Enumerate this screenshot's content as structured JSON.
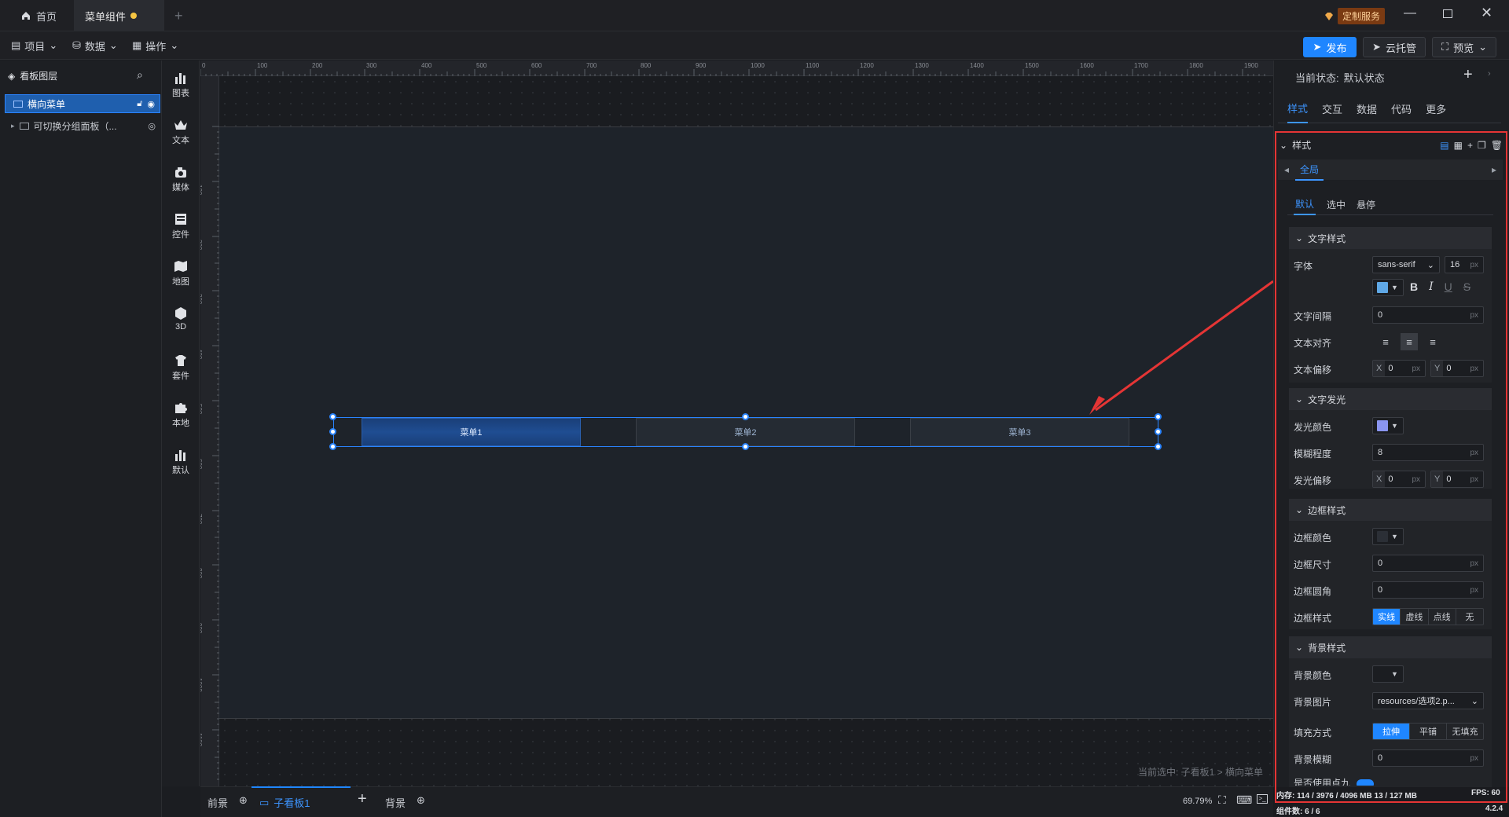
{
  "titlebar": {
    "tabs": [
      {
        "label": "首页",
        "icon": "home-icon"
      },
      {
        "label": "菜单组件",
        "modified": true
      }
    ],
    "service_label": "定制服务",
    "window_controls": [
      "minimize-icon",
      "restore-icon",
      "close-icon"
    ]
  },
  "menubar": {
    "project_label": "项目",
    "data_label": "数据",
    "ops_label": "操作",
    "publish_label": "发布",
    "cloud_label": "云托管",
    "preview_label": "预览"
  },
  "layers": {
    "title": "看板图层",
    "items": [
      {
        "label": "横向菜单",
        "selected": true
      },
      {
        "label": "可切换分组面板（...",
        "selected": false
      }
    ]
  },
  "tools": [
    {
      "label": "图表",
      "icon": "chart-icon"
    },
    {
      "label": "文本",
      "icon": "text-icon"
    },
    {
      "label": "媒体",
      "icon": "media-icon"
    },
    {
      "label": "控件",
      "icon": "control-icon"
    },
    {
      "label": "地图",
      "icon": "map-icon"
    },
    {
      "label": "3D",
      "icon": "cube-icon"
    },
    {
      "label": "套件",
      "icon": "suite-icon"
    },
    {
      "label": "本地",
      "icon": "puzzle-icon"
    },
    {
      "label": "默认",
      "icon": "bar-icon"
    }
  ],
  "ruler": {
    "top_ticks": [
      "0",
      "100",
      "200",
      "300",
      "400",
      "500",
      "600",
      "700",
      "800",
      "900",
      "1000",
      "1100",
      "1200",
      "1300",
      "1400",
      "1500",
      "1600",
      "1700",
      "1800",
      "1900"
    ],
    "left_ticks": [
      "100",
      "200",
      "300",
      "400",
      "500",
      "600",
      "700",
      "800",
      "900",
      "1000",
      "1100"
    ]
  },
  "canvas": {
    "menu_items": [
      "菜单1",
      "菜单2",
      "菜单3"
    ],
    "selection_path": "当前选中: 子看板1 > 横向菜单"
  },
  "bottombar": {
    "foreground_label": "前景",
    "board_tab": "子看板1",
    "background_label": "背景",
    "zoom": "69.79%"
  },
  "rpanel": {
    "state_label": "当前状态:",
    "state_value": "默认状态",
    "tabs": [
      "样式",
      "交互",
      "数据",
      "代码",
      "更多"
    ],
    "style_title": "样式",
    "scope_tab": "全局",
    "state_tabs": [
      "默认",
      "选中",
      "悬停"
    ],
    "text_style": {
      "title": "文字样式",
      "font_label": "字体",
      "font_value": "sans-serif",
      "font_size": "16",
      "color": "#5fa8e6",
      "spacing_label": "文字间隔",
      "spacing_value": "0",
      "align_label": "文本对齐",
      "offset_label": "文本偏移",
      "offset_x": "0",
      "offset_y": "0"
    },
    "glow": {
      "title": "文字发光",
      "color_label": "发光颜色",
      "color": "#8a95f0",
      "blur_label": "模糊程度",
      "blur_value": "8",
      "offset_label": "发光偏移",
      "offset_x": "0",
      "offset_y": "0"
    },
    "border": {
      "title": "边框样式",
      "color_label": "边框颜色",
      "color": "#2b2f36",
      "size_label": "边框尺寸",
      "size_value": "0",
      "radius_label": "边框圆角",
      "radius_value": "0",
      "style_label": "边框样式",
      "styles": [
        "实线",
        "虚线",
        "点线",
        "无"
      ]
    },
    "background": {
      "title": "背景样式",
      "color_label": "背景颜色",
      "image_label": "背景图片",
      "image_value": "resources/选项2.p...",
      "fill_label": "填充方式",
      "fills": [
        "拉伸",
        "平铺",
        "无填充"
      ],
      "blur_label": "背景模糊",
      "blur_value": "0",
      "cut_label": "是否使用点九"
    },
    "unit_px": "px",
    "x_label": "X",
    "y_label": "Y",
    "status": {
      "memory": "内存: 114 / 3976 / 4096 MB  13 / 127 MB",
      "fps": "FPS: 60",
      "components": "组件数: 6 / 6",
      "version": "4.2.4"
    }
  }
}
